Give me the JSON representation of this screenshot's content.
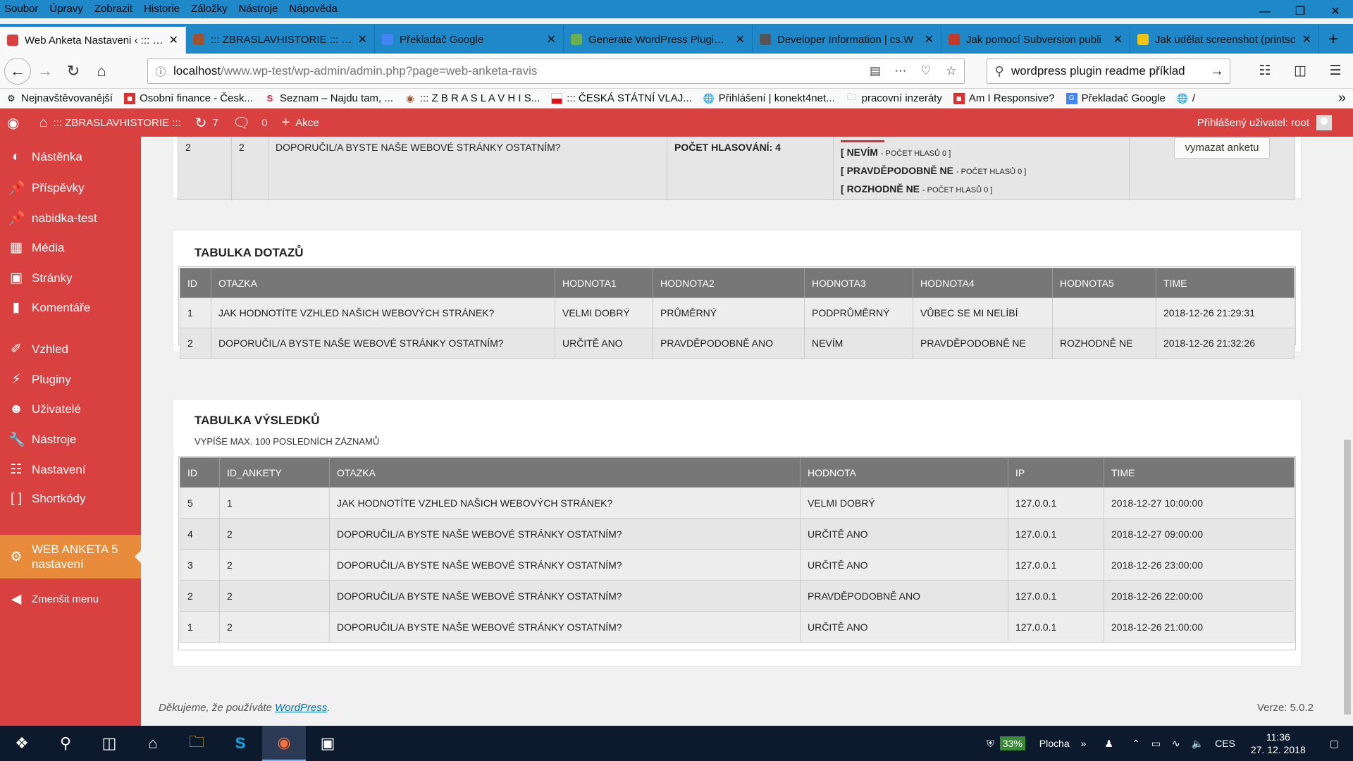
{
  "browser": {
    "menu": [
      "Soubor",
      "Úpravy",
      "Zobrazit",
      "Historie",
      "Záložky",
      "Nástroje",
      "Nápověda"
    ],
    "tabs": [
      {
        "title": "Web Anketa Nastaveni ‹ ::: ZB",
        "color": "#d94040",
        "active": true
      },
      {
        "title": "::: ZBRASLAVHISTORIE ::: – str",
        "color": "#a0522d",
        "active": false
      },
      {
        "title": "Překladač Google",
        "color": "#4285f4",
        "active": false
      },
      {
        "title": "Generate WordPress Plugin re",
        "color": "#6ab04c",
        "active": false
      },
      {
        "title": "Developer Information | cs.W",
        "color": "#555555",
        "active": false
      },
      {
        "title": "Jak pomocí Subversion publi",
        "color": "#c0392b",
        "active": false
      },
      {
        "title": "Jak udělat screenshot (printsc",
        "color": "#f1c40f",
        "active": false
      }
    ],
    "url_host": "localhost",
    "url_path": "/www.wp-test/wp-admin/admin.php?page=web-anketa-ravis",
    "search_value": "wordpress plugin readme příklad",
    "bookmarks": [
      {
        "label": "Nejnavštěvovanější",
        "icon": "gear-icon"
      },
      {
        "label": "Osobní finance - Česk...",
        "icon": "finance-icon"
      },
      {
        "label": "Seznam – Najdu tam, ...",
        "icon": "seznam-icon"
      },
      {
        "label": "::: Z B R A S L A V H I S...",
        "icon": "zbraslav-icon"
      },
      {
        "label": "::: ČESKÁ STÁTNÍ VLAJ...",
        "icon": "flag-icon"
      },
      {
        "label": "Přihlášení | konekt4net...",
        "icon": "globe-icon"
      },
      {
        "label": "pracovní inzeráty",
        "icon": "folder-icon"
      },
      {
        "label": "Am I Responsive?",
        "icon": "responsive-icon"
      },
      {
        "label": "Překladač Google",
        "icon": "translate-icon"
      },
      {
        "label": "/",
        "icon": "globe-icon"
      }
    ]
  },
  "adminbar": {
    "site_name": "::: ZBRASLAVHISTORIE :::",
    "updates_count": "7",
    "comments_count": "0",
    "new_label": "Akce",
    "user_label": "Přihlášený uživatel: root"
  },
  "sidebar": {
    "items": [
      {
        "label": "Nástěnka",
        "icon": "dashboard-icon"
      },
      {
        "label": "Příspěvky",
        "icon": "pin-icon"
      },
      {
        "label": "nabidka-test",
        "icon": "pin-icon"
      },
      {
        "label": "Média",
        "icon": "media-icon"
      },
      {
        "label": "Stránky",
        "icon": "pages-icon"
      },
      {
        "label": "Komentáře",
        "icon": "comment-icon"
      },
      {
        "label": "Vzhled",
        "icon": "brush-icon"
      },
      {
        "label": "Pluginy",
        "icon": "plugin-icon"
      },
      {
        "label": "Uživatelé",
        "icon": "user-icon"
      },
      {
        "label": "Nástroje",
        "icon": "wrench-icon"
      },
      {
        "label": "Nastavení",
        "icon": "settings-icon"
      },
      {
        "label": "Shortkódy",
        "icon": "brackets-icon"
      },
      {
        "label": "WEB ANKETA 5 nastavení",
        "icon": "gear-icon"
      },
      {
        "label": "Zmenšit menu",
        "icon": "collapse-icon"
      }
    ]
  },
  "top_row": {
    "id": "2",
    "id_anketa": "2",
    "question": "DOPORUČIL/A BYSTE NAŠE WEBOVÉ STRÁNKY OSTATNÍM?",
    "votes": "POČET HLASOVÁNÍ: 4",
    "answers": [
      {
        "label": "NEVÍM",
        "count": "POČET HLASŮ 0"
      },
      {
        "label": "PRAVDĚPODOBNĚ NE",
        "count": "POČET HLASŮ 0"
      },
      {
        "label": "ROZHODNĚ NE",
        "count": "POČET HLASŮ 0"
      }
    ],
    "delete_label": "vymazat anketu"
  },
  "dotazy": {
    "title": "TABULKA DOTAZŮ",
    "headers": [
      "ID",
      "OTAZKA",
      "HODNOTA1",
      "HODNOTA2",
      "HODNOTA3",
      "HODNOTA4",
      "HODNOTA5",
      "TIME"
    ],
    "rows": [
      [
        "1",
        "JAK HODNOTÍTE VZHLED NAŠICH WEBOVÝCH STRÁNEK?",
        "VELMI DOBRÝ",
        "PRŮMĚRNÝ",
        "PODPRŮMĚRNÝ",
        "VŮBEC SE MI NELÍBÍ",
        "",
        "2018-12-26 21:29:31"
      ],
      [
        "2",
        "DOPORUČIL/A BYSTE NAŠE WEBOVÉ STRÁNKY OSTATNÍM?",
        "URČITĚ ANO",
        "PRAVDĚPODOBNĚ ANO",
        "NEVÍM",
        "PRAVDĚPODOBNĚ NE",
        "ROZHODNĚ NE",
        "2018-12-26 21:32:26"
      ]
    ]
  },
  "vysledky": {
    "title": "TABULKA VÝSLEDKŮ",
    "subtitle": "VYPÍŠE MAX. 100 POSLEDNÍCH ZÁZNAMŮ",
    "headers": [
      "ID",
      "ID_ANKETY",
      "OTAZKA",
      "HODNOTA",
      "IP",
      "TIME"
    ],
    "rows": [
      [
        "5",
        "1",
        "JAK HODNOTÍTE VZHLED NAŠICH WEBOVÝCH STRÁNEK?",
        "VELMI DOBRÝ",
        "127.0.0.1",
        "2018-12-27 10:00:00"
      ],
      [
        "4",
        "2",
        "DOPORUČIL/A BYSTE NAŠE WEBOVÉ STRÁNKY OSTATNÍM?",
        "URČITĚ ANO",
        "127.0.0.1",
        "2018-12-27 09:00:00"
      ],
      [
        "3",
        "2",
        "DOPORUČIL/A BYSTE NAŠE WEBOVÉ STRÁNKY OSTATNÍM?",
        "URČITĚ ANO",
        "127.0.0.1",
        "2018-12-26 23:00:00"
      ],
      [
        "2",
        "2",
        "DOPORUČIL/A BYSTE NAŠE WEBOVÉ STRÁNKY OSTATNÍM?",
        "PRAVDĚPODOBNĚ ANO",
        "127.0.0.1",
        "2018-12-26 22:00:00"
      ],
      [
        "1",
        "2",
        "DOPORUČIL/A BYSTE NAŠE WEBOVÉ STRÁNKY OSTATNÍM?",
        "URČITĚ ANO",
        "127.0.0.1",
        "2018-12-26 21:00:00"
      ]
    ]
  },
  "footer": {
    "thanks_prefix": "Děkujeme, že používáte ",
    "wp_link": "WordPress",
    "thanks_suffix": ".",
    "version": "Verze: 5.0.2"
  },
  "taskbar": {
    "battery": "33%",
    "desktop_label": "Plocha",
    "lang": "CES",
    "time": "11:36",
    "date": "27. 12. 2018"
  },
  "colors": {
    "admin_red": "#d94040",
    "current_orange": "#e88b3a",
    "firefox_blue": "#1e88c8"
  }
}
